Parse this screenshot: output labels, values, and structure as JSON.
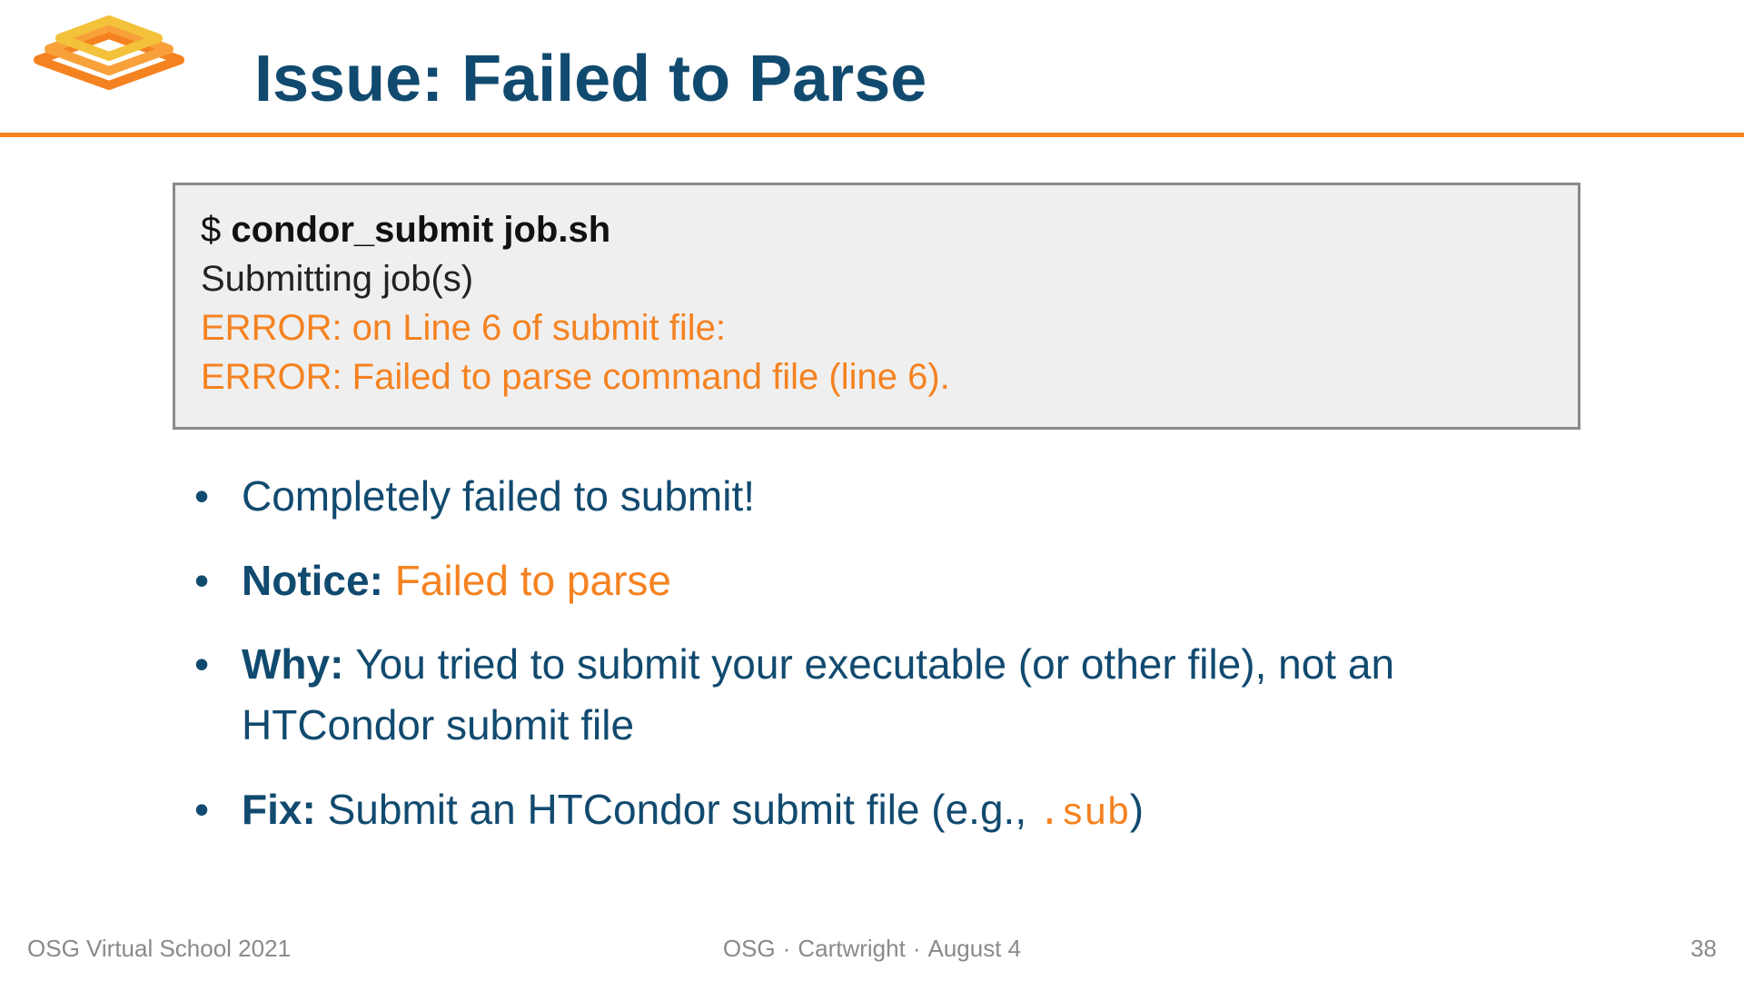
{
  "header": {
    "title": "Issue: Failed to Parse"
  },
  "codebox": {
    "prompt": "$ ",
    "command": "condor_submit job.sh",
    "line2": "Submitting job(s)",
    "line3": "ERROR: on Line 6 of submit file:",
    "line4": "ERROR: Failed to parse command file (line 6)."
  },
  "bullets": {
    "b1": "Completely failed to submit!",
    "b2_label": "Notice: ",
    "b2_detail": "Failed to parse",
    "b3_label": "Why: ",
    "b3_text": "You tried to submit your executable (or other file), not an HTCondor submit file",
    "b4_label": "Fix: ",
    "b4_text_a": "Submit an HTCondor submit file (e.g., ",
    "b4_mono": ".sub",
    "b4_text_b": ")"
  },
  "footer": {
    "left": "OSG Virtual School 2021",
    "center_a": "OSG",
    "center_b": "Cartwright",
    "center_c": "August 4",
    "page": "38"
  }
}
